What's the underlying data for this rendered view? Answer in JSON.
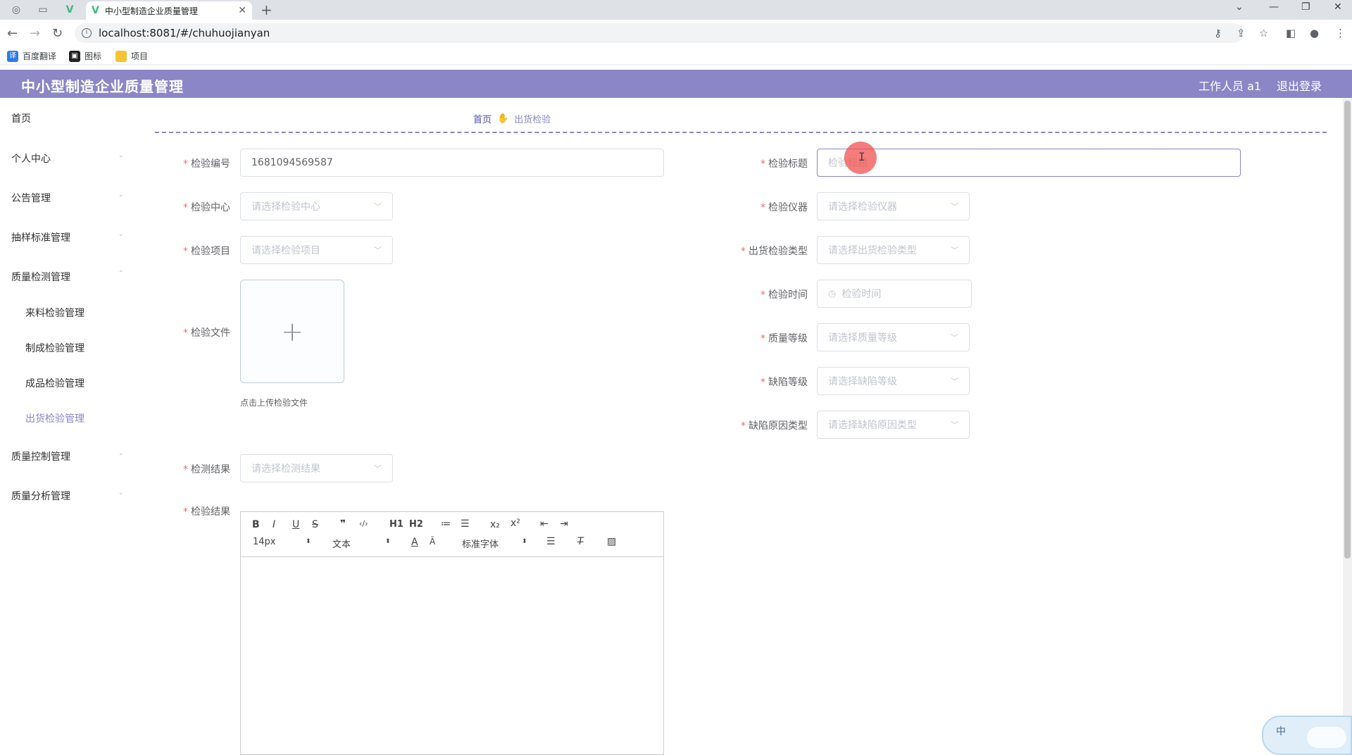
{
  "browser": {
    "tab_title": "中小型制造企业质量管理",
    "url": "localhost:8081/#/chuhuojianyan",
    "bookmarks": [
      "百度翻译",
      "图标",
      "项目"
    ]
  },
  "header": {
    "title": "中小型制造企业质量管理",
    "user": "工作人员 a1",
    "logout": "退出登录"
  },
  "sidebar": {
    "items": [
      {
        "label": "首页"
      },
      {
        "label": "个人中心"
      },
      {
        "label": "公告管理"
      },
      {
        "label": "抽样标准管理"
      },
      {
        "label": "质量检测管理"
      },
      {
        "label": "质量控制管理"
      },
      {
        "label": "质量分析管理"
      }
    ],
    "sub_items": [
      {
        "label": "来料检验管理"
      },
      {
        "label": "制成检验管理"
      },
      {
        "label": "成品检验管理"
      },
      {
        "label": "出货检验管理"
      }
    ]
  },
  "breadcrumb": {
    "home": "首页",
    "current": "出货检验"
  },
  "form": {
    "code": {
      "label": "检验编号",
      "value": "1681094569587"
    },
    "title": {
      "label": "检验标题",
      "placeholder": "检验标题"
    },
    "center": {
      "label": "检验中心",
      "placeholder": "请选择检验中心"
    },
    "instrument": {
      "label": "检验仪器",
      "placeholder": "请选择检验仪器"
    },
    "item": {
      "label": "检验项目",
      "placeholder": "请选择检验项目"
    },
    "ship_type": {
      "label": "出货检验类型",
      "placeholder": "请选择出货检验类型"
    },
    "time": {
      "label": "检验时间",
      "placeholder": "检验时间"
    },
    "file": {
      "label": "检验文件",
      "tip": "点击上传检验文件"
    },
    "quality_level": {
      "label": "质量等级",
      "placeholder": "请选择质量等级"
    },
    "defect_level": {
      "label": "缺陷等级",
      "placeholder": "请选择缺陷等级"
    },
    "defect_cause": {
      "label": "缺陷原因类型",
      "placeholder": "请选择缺陷原因类型"
    },
    "detect_result": {
      "label": "检测结果",
      "placeholder": "请选择检测结果"
    },
    "result_text": {
      "label": "检验结果"
    }
  },
  "editor": {
    "toolbar_row1": [
      "B",
      "I",
      "U",
      "S",
      "❞",
      "‹/›",
      "H1",
      "H2",
      "≔",
      "☰",
      "x₂",
      "x²",
      "⇤",
      "⇥"
    ],
    "font_size": "14px",
    "text_style": "文本",
    "font_family": "标准字体"
  },
  "widget": {
    "text": "中"
  }
}
